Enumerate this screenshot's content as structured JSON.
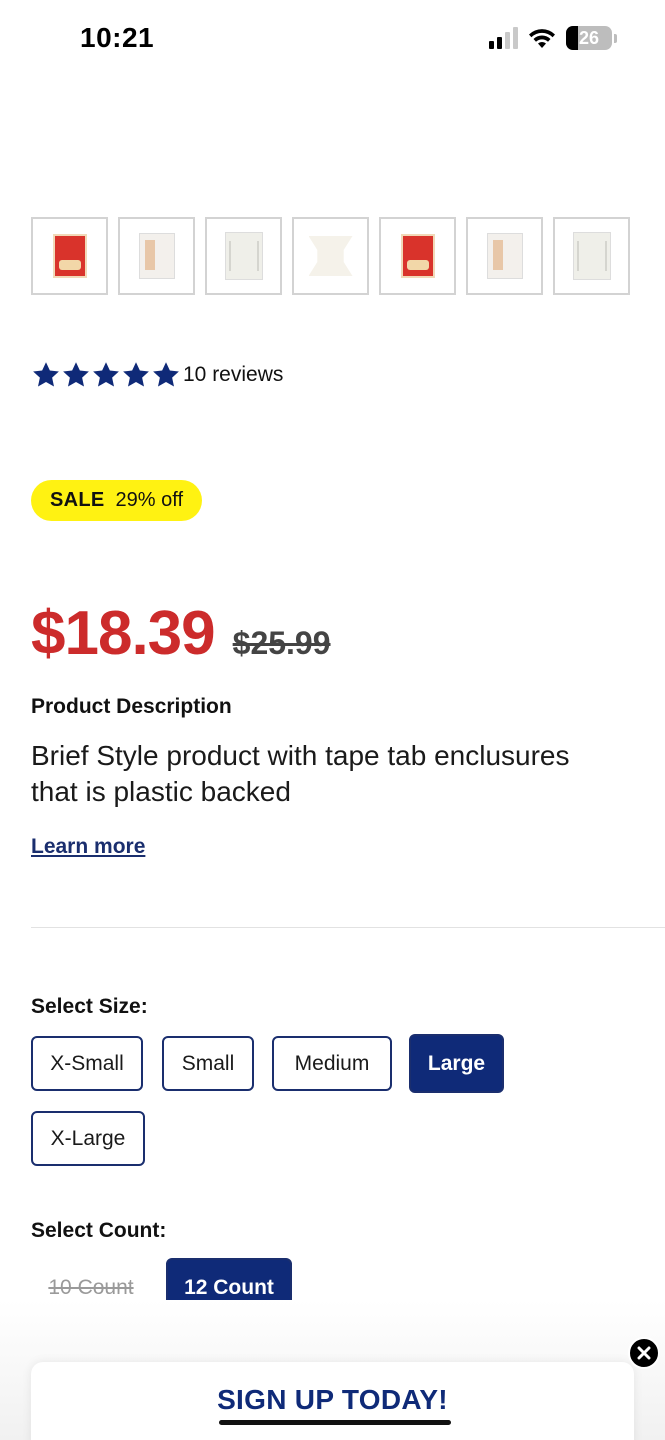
{
  "status_bar": {
    "time": "10:21",
    "battery": "26"
  },
  "gallery": {
    "thumbnails": [
      {
        "icon": "product-package-front-icon"
      },
      {
        "icon": "product-package-side-icon"
      },
      {
        "icon": "product-package-back-icon"
      },
      {
        "icon": "product-brief-icon"
      },
      {
        "icon": "product-package-front-icon"
      },
      {
        "icon": "product-package-side-icon"
      },
      {
        "icon": "product-package-back-icon"
      }
    ]
  },
  "rating": {
    "stars": 5,
    "reviews_text": "10 reviews",
    "star_color": "#0f2a78"
  },
  "sale": {
    "label": "SALE",
    "discount": "29% off",
    "badge_color": "#fff212"
  },
  "price": {
    "current": "$18.39",
    "original": "$25.99",
    "current_color": "#cc2b2b"
  },
  "description": {
    "title": "Product Description",
    "body": "Brief Style product with tape tab enclusures that is plastic backed",
    "learn_more": "Learn more"
  },
  "size": {
    "label": "Select Size:",
    "options": [
      "X-Small",
      "Small",
      "Medium",
      "Large",
      "X-Large"
    ],
    "selected": "Large"
  },
  "count": {
    "label": "Select Count:",
    "options": [
      "10 Count",
      "12 Count"
    ],
    "selected": "12 Count",
    "unavailable": [
      "10 Count"
    ]
  },
  "promo": {
    "signup_text": "SIGN UP TODAY!"
  },
  "colors": {
    "brand_navy": "#0f2a78",
    "sale_red": "#cc2b2b"
  }
}
